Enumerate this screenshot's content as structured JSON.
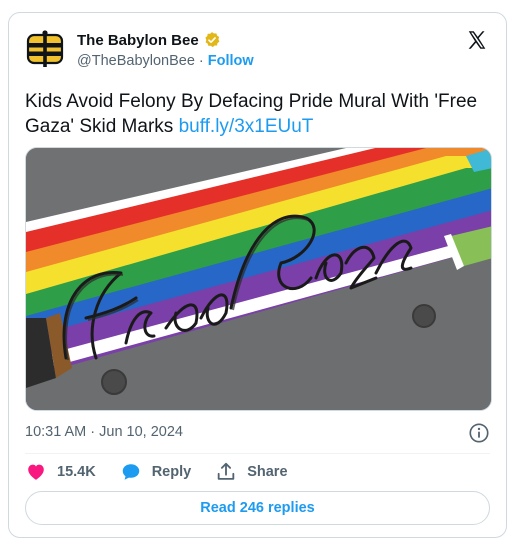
{
  "author": {
    "name": "The Babylon Bee",
    "handle": "@TheBabylonBee",
    "separator": "·",
    "follow_label": "Follow",
    "verified_badge": "gold-verified-badge",
    "brand_color": "#0f1419"
  },
  "tweet": {
    "text": "Kids Avoid Felony By Defacing Pride Mural With 'Free Gaza' Skid Marks",
    "link": "buff.ly/3x1EUuT",
    "media_caption": "Free Gaza",
    "timestamp": "10:31 AM · Jun 10, 2024"
  },
  "actions": {
    "like_count": "15.4K",
    "reply_label": "Reply",
    "share_label": "Share",
    "read_replies_label": "Read 246 replies"
  },
  "icons": {
    "platform": "x-logo-icon",
    "info": "info-icon",
    "like": "heart-icon",
    "reply": "reply-bubble-icon",
    "share": "share-upload-icon"
  },
  "colors": {
    "accent": "#1d9bf0",
    "like": "#f91880",
    "secondary_text": "#536471",
    "border": "#cfd9de"
  }
}
